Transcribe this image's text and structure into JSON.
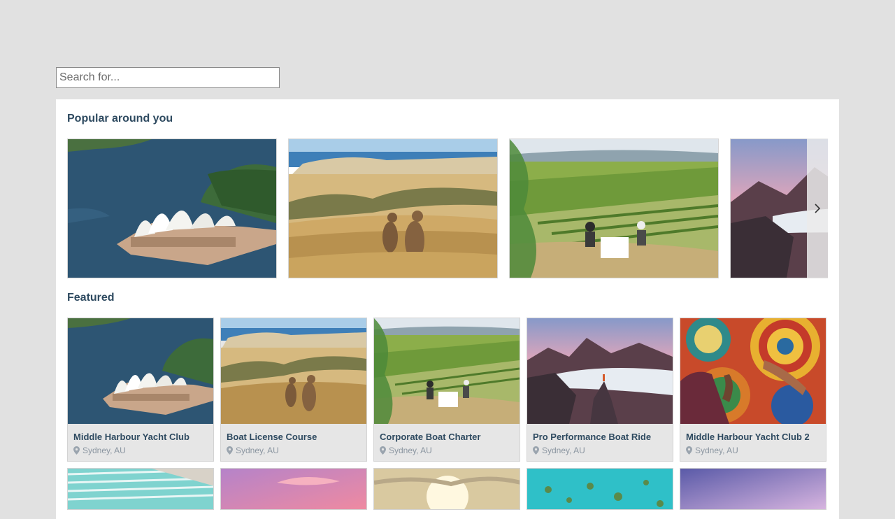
{
  "search": {
    "placeholder": "Search for..."
  },
  "popular": {
    "title": "Popular around you",
    "cards": [
      {
        "scene": "opera-house"
      },
      {
        "scene": "kangaroos"
      },
      {
        "scene": "vineyard"
      },
      {
        "scene": "mountain"
      }
    ],
    "next_icon": "chevron-right-icon"
  },
  "featured": {
    "title": "Featured",
    "cards": [
      {
        "name": "Middle Harbour Yacht Club",
        "location": "Sydney, AU",
        "scene": "opera-house"
      },
      {
        "name": "Boat License Course",
        "location": "Sydney, AU",
        "scene": "kangaroos"
      },
      {
        "name": "Corporate Boat Charter",
        "location": "Sydney, AU",
        "scene": "vineyard"
      },
      {
        "name": "Pro Performance Boat Ride",
        "location": "Sydney, AU",
        "scene": "mountain"
      },
      {
        "name": "Middle Harbour Yacht Club 2",
        "location": "Sydney, AU",
        "scene": "aboriginal-art"
      }
    ],
    "second_row": [
      {
        "scene": "pool"
      },
      {
        "scene": "pink-sky"
      },
      {
        "scene": "sunset"
      },
      {
        "scene": "reef"
      },
      {
        "scene": "purple-sky"
      }
    ]
  },
  "colors": {
    "background": "#e1e1e1",
    "panel": "#ffffff",
    "heading": "#2e4a60",
    "location": "#8a95a0"
  }
}
